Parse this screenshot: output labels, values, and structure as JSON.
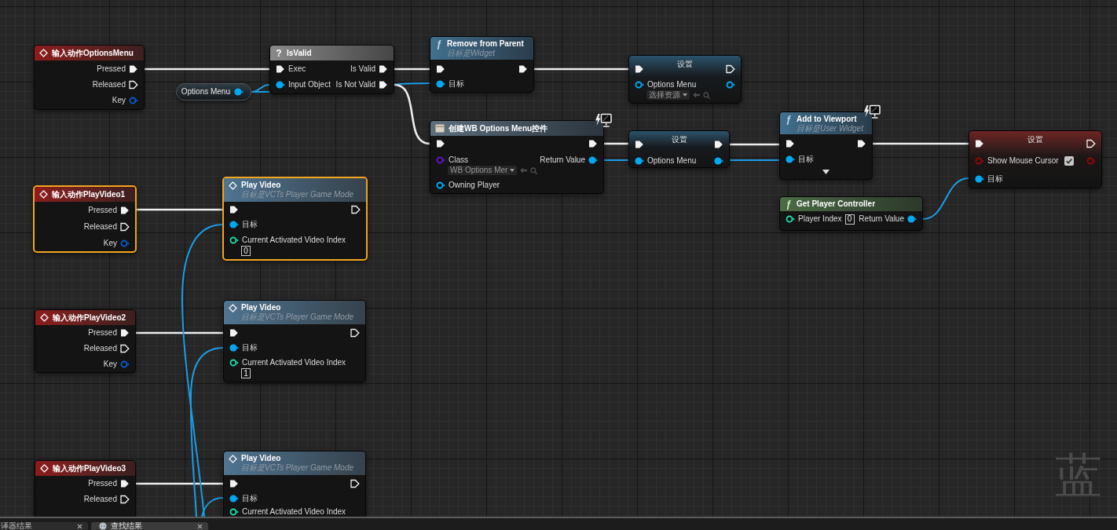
{
  "graph": {
    "nodes": [
      {
        "kind": "input-action",
        "title": "输入动作OptionsMenu",
        "selected": false,
        "client_icon": false,
        "advanced_collapsed": false,
        "rows": [
          {
            "out": {
              "kind": "exec",
              "label": "Pressed",
              "connected": true
            }
          },
          {
            "out": {
              "kind": "exec",
              "label": "Released",
              "connected": false
            }
          },
          {
            "out": {
              "kind": "key",
              "label": "Key",
              "connected": false
            }
          }
        ]
      },
      {
        "kind": "variable-get",
        "title": "Options Menu",
        "selected": false,
        "client_icon": false,
        "advanced_collapsed": false,
        "rows": [
          {
            "out": {
              "kind": "object",
              "connected": true
            }
          }
        ]
      },
      {
        "kind": "macro",
        "glyph": "?",
        "title": "IsValid",
        "selected": false,
        "client_icon": false,
        "advanced_collapsed": false,
        "rows": [
          {
            "in": {
              "kind": "exec",
              "label": "Exec",
              "connected": true
            },
            "out": {
              "kind": "exec",
              "label": "Is Valid",
              "connected": true
            }
          },
          {
            "in": {
              "kind": "object",
              "label": "Input Object",
              "connected": true
            },
            "out": {
              "kind": "exec",
              "label": "Is Not Valid",
              "connected": true
            }
          }
        ]
      },
      {
        "kind": "function",
        "glyph": "ƒ",
        "title": "Remove from Parent",
        "subtitle": "目标是Widget",
        "selected": false,
        "client_icon": false,
        "advanced_collapsed": false,
        "rows": [
          {
            "in": {
              "kind": "exec",
              "connected": true
            },
            "out": {
              "kind": "exec",
              "connected": true
            }
          },
          {
            "in": {
              "kind": "object",
              "label": "目标",
              "connected": true
            }
          }
        ]
      },
      {
        "kind": "set",
        "title": "设置",
        "selected": false,
        "client_icon": false,
        "advanced_collapsed": false,
        "rows": [
          {
            "in": {
              "kind": "exec",
              "connected": true
            },
            "out": {
              "kind": "exec",
              "connected": false
            }
          },
          {
            "in": {
              "kind": "object",
              "label": "Options Menu",
              "connected": false,
              "default": {
                "kind": "asset",
                "text": "选择资源"
              }
            },
            "out": {
              "kind": "object",
              "connected": false
            }
          }
        ]
      },
      {
        "kind": "create-widget",
        "title": "创建WB Options Menu控件",
        "selected": false,
        "client_icon": true,
        "advanced_collapsed": false,
        "rows": [
          {
            "in": {
              "kind": "exec",
              "connected": true
            },
            "out": {
              "kind": "exec",
              "connected": true
            }
          },
          {
            "in": {
              "kind": "class",
              "label": "Class",
              "connected": false,
              "default": {
                "kind": "asset",
                "text": "WB Options Mer"
              }
            },
            "out": {
              "kind": "object",
              "label": "Return Value",
              "connected": true
            }
          },
          {
            "in": {
              "kind": "object",
              "label": "Owning Player",
              "connected": false
            }
          }
        ]
      },
      {
        "kind": "set",
        "title": "设置",
        "selected": false,
        "client_icon": false,
        "advanced_collapsed": false,
        "rows": [
          {
            "in": {
              "kind": "exec",
              "connected": true
            },
            "out": {
              "kind": "exec",
              "connected": true
            }
          },
          {
            "in": {
              "kind": "object",
              "label": "Options Menu",
              "connected": true
            },
            "out": {
              "kind": "object",
              "connected": true
            }
          }
        ]
      },
      {
        "kind": "function",
        "glyph": "ƒ",
        "title": "Add to Viewport",
        "subtitle": "目标是User Widget",
        "selected": false,
        "client_icon": true,
        "advanced_collapsed": true,
        "rows": [
          {
            "in": {
              "kind": "exec",
              "connected": true
            },
            "out": {
              "kind": "exec",
              "connected": true
            }
          },
          {
            "in": {
              "kind": "object",
              "label": "目标",
              "connected": true
            }
          }
        ]
      },
      {
        "kind": "set",
        "title": "设置",
        "selected": false,
        "client_icon": false,
        "advanced_collapsed": false,
        "rows": [
          {
            "in": {
              "kind": "exec",
              "connected": true
            },
            "out": {
              "kind": "exec",
              "connected": false
            }
          },
          {
            "in": {
              "kind": "bool",
              "label": "Show Mouse Cursor",
              "connected": false,
              "default": {
                "kind": "checkbox",
                "checked": true
              }
            },
            "out": {
              "kind": "bool",
              "connected": false
            }
          },
          {
            "in": {
              "kind": "object",
              "label": "目标",
              "connected": true
            }
          }
        ]
      },
      {
        "kind": "pure-function",
        "glyph": "ƒ",
        "title": "Get Player Controller",
        "selected": false,
        "client_icon": false,
        "advanced_collapsed": false,
        "rows": [
          {
            "in": {
              "kind": "int",
              "label": "Player Index",
              "connected": false,
              "default": {
                "kind": "number",
                "text": "0"
              }
            },
            "out": {
              "kind": "object",
              "label": "Return Value",
              "connected": true
            }
          }
        ]
      },
      {
        "kind": "input-action",
        "title": "输入动作PlayVideo1",
        "selected": true,
        "client_icon": false,
        "advanced_collapsed": false,
        "rows": [
          {
            "out": {
              "kind": "exec",
              "label": "Pressed",
              "connected": true
            }
          },
          {
            "out": {
              "kind": "exec",
              "label": "Released",
              "connected": false
            }
          },
          {
            "out": {
              "kind": "key",
              "label": "Key",
              "connected": false
            }
          }
        ]
      },
      {
        "kind": "event-call",
        "title": "Play Video",
        "subtitle": "目标是VCTs Player Game Mode",
        "selected": true,
        "client_icon": false,
        "advanced_collapsed": false,
        "rows": [
          {
            "in": {
              "kind": "exec",
              "connected": true
            },
            "out": {
              "kind": "exec",
              "connected": false
            }
          },
          {
            "in": {
              "kind": "object",
              "label": "目标",
              "connected": true
            }
          },
          {
            "in": {
              "kind": "int",
              "label": "Current Activated Video Index",
              "connected": false,
              "default": {
                "kind": "number",
                "text": "0"
              }
            }
          }
        ]
      },
      {
        "kind": "input-action",
        "title": "输入动作PlayVideo2",
        "selected": false,
        "client_icon": false,
        "advanced_collapsed": false,
        "rows": [
          {
            "out": {
              "kind": "exec",
              "label": "Pressed",
              "connected": true
            }
          },
          {
            "out": {
              "kind": "exec",
              "label": "Released",
              "connected": false
            }
          },
          {
            "out": {
              "kind": "key",
              "label": "Key",
              "connected": false
            }
          }
        ]
      },
      {
        "kind": "event-call",
        "title": "Play Video",
        "subtitle": "目标是VCTs Player Game Mode",
        "selected": false,
        "client_icon": false,
        "advanced_collapsed": false,
        "rows": [
          {
            "in": {
              "kind": "exec",
              "connected": true
            },
            "out": {
              "kind": "exec",
              "connected": false
            }
          },
          {
            "in": {
              "kind": "object",
              "label": "目标",
              "connected": true
            }
          },
          {
            "in": {
              "kind": "int",
              "label": "Current Activated Video Index",
              "connected": false,
              "default": {
                "kind": "number",
                "text": "1"
              }
            }
          }
        ]
      },
      {
        "kind": "input-action",
        "title": "输入动作PlayVideo3",
        "selected": false,
        "client_icon": false,
        "advanced_collapsed": false,
        "rows": [
          {
            "out": {
              "kind": "exec",
              "label": "Pressed",
              "connected": true
            }
          },
          {
            "out": {
              "kind": "exec",
              "label": "Released",
              "connected": false
            }
          }
        ]
      },
      {
        "kind": "event-call",
        "title": "Play Video",
        "subtitle": "目标是VCTs Player Game Mode",
        "selected": false,
        "client_icon": false,
        "advanced_collapsed": false,
        "rows": [
          {
            "in": {
              "kind": "exec",
              "connected": true
            },
            "out": {
              "kind": "exec",
              "connected": false
            }
          },
          {
            "in": {
              "kind": "object",
              "label": "目标",
              "connected": true
            }
          },
          {
            "in": {
              "kind": "int",
              "label": "Current Activated Video Index",
              "connected": false
            }
          }
        ]
      }
    ],
    "graph_label": "蓝"
  },
  "bottom_tabs": [
    {
      "label": "译器结果",
      "selected": false,
      "icon": false
    },
    {
      "label": "查找结果",
      "selected": true,
      "icon": true
    }
  ]
}
